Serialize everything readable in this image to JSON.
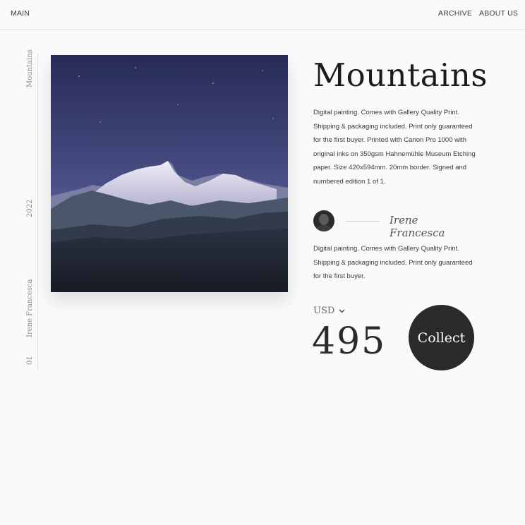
{
  "nav": {
    "main_label": "MAIN",
    "archive_label": "ARCHIVE",
    "about_label": "ABOUT US"
  },
  "sidebar": {
    "title": "Mountains",
    "year": "2022",
    "artist": "Irene Francesca",
    "number": "01"
  },
  "artwork": {
    "title": "Mountains",
    "description": "Digital painting. Comes with Gallery Quality Print. Shipping & packaging included. Print only guaranteed for the first buyer. Printed with Canon Pro 1000 with original inks on 350gsm Hahnemühle Museum Etching paper. Size 420x594mm. 20mm border. Signed and numbered edition 1 of 1.",
    "artist": "Irene Francesca",
    "short_description": "Digital painting. Comes with Gallery Quality Print. Shipping & packaging included. Print only guaranteed for the first buyer.",
    "image_icon": "mountain-landscape-image"
  },
  "purchase": {
    "currency": "USD",
    "price": "495",
    "collect_label": "Collect"
  },
  "colors": {
    "background": "#fafafa",
    "button": "#2a2a2a",
    "sky_top": "#2a2f5e",
    "sky_bottom": "#6a6aa0",
    "snow": "#e8e4f2"
  }
}
